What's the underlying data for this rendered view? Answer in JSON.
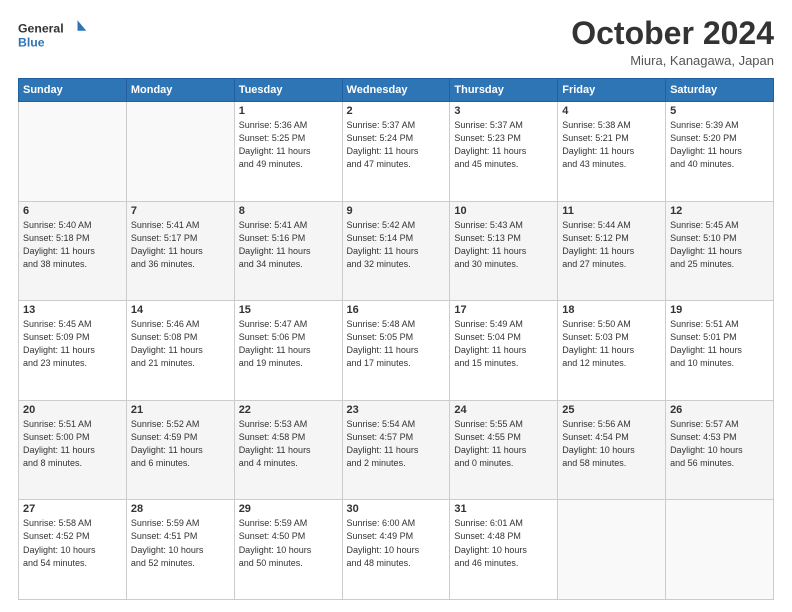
{
  "header": {
    "logo_line1": "General",
    "logo_line2": "Blue",
    "month_title": "October 2024",
    "location": "Miura, Kanagawa, Japan"
  },
  "weekdays": [
    "Sunday",
    "Monday",
    "Tuesday",
    "Wednesday",
    "Thursday",
    "Friday",
    "Saturday"
  ],
  "weeks": [
    [
      {
        "day": "",
        "info": ""
      },
      {
        "day": "",
        "info": ""
      },
      {
        "day": "1",
        "info": "Sunrise: 5:36 AM\nSunset: 5:25 PM\nDaylight: 11 hours\nand 49 minutes."
      },
      {
        "day": "2",
        "info": "Sunrise: 5:37 AM\nSunset: 5:24 PM\nDaylight: 11 hours\nand 47 minutes."
      },
      {
        "day": "3",
        "info": "Sunrise: 5:37 AM\nSunset: 5:23 PM\nDaylight: 11 hours\nand 45 minutes."
      },
      {
        "day": "4",
        "info": "Sunrise: 5:38 AM\nSunset: 5:21 PM\nDaylight: 11 hours\nand 43 minutes."
      },
      {
        "day": "5",
        "info": "Sunrise: 5:39 AM\nSunset: 5:20 PM\nDaylight: 11 hours\nand 40 minutes."
      }
    ],
    [
      {
        "day": "6",
        "info": "Sunrise: 5:40 AM\nSunset: 5:18 PM\nDaylight: 11 hours\nand 38 minutes."
      },
      {
        "day": "7",
        "info": "Sunrise: 5:41 AM\nSunset: 5:17 PM\nDaylight: 11 hours\nand 36 minutes."
      },
      {
        "day": "8",
        "info": "Sunrise: 5:41 AM\nSunset: 5:16 PM\nDaylight: 11 hours\nand 34 minutes."
      },
      {
        "day": "9",
        "info": "Sunrise: 5:42 AM\nSunset: 5:14 PM\nDaylight: 11 hours\nand 32 minutes."
      },
      {
        "day": "10",
        "info": "Sunrise: 5:43 AM\nSunset: 5:13 PM\nDaylight: 11 hours\nand 30 minutes."
      },
      {
        "day": "11",
        "info": "Sunrise: 5:44 AM\nSunset: 5:12 PM\nDaylight: 11 hours\nand 27 minutes."
      },
      {
        "day": "12",
        "info": "Sunrise: 5:45 AM\nSunset: 5:10 PM\nDaylight: 11 hours\nand 25 minutes."
      }
    ],
    [
      {
        "day": "13",
        "info": "Sunrise: 5:45 AM\nSunset: 5:09 PM\nDaylight: 11 hours\nand 23 minutes."
      },
      {
        "day": "14",
        "info": "Sunrise: 5:46 AM\nSunset: 5:08 PM\nDaylight: 11 hours\nand 21 minutes."
      },
      {
        "day": "15",
        "info": "Sunrise: 5:47 AM\nSunset: 5:06 PM\nDaylight: 11 hours\nand 19 minutes."
      },
      {
        "day": "16",
        "info": "Sunrise: 5:48 AM\nSunset: 5:05 PM\nDaylight: 11 hours\nand 17 minutes."
      },
      {
        "day": "17",
        "info": "Sunrise: 5:49 AM\nSunset: 5:04 PM\nDaylight: 11 hours\nand 15 minutes."
      },
      {
        "day": "18",
        "info": "Sunrise: 5:50 AM\nSunset: 5:03 PM\nDaylight: 11 hours\nand 12 minutes."
      },
      {
        "day": "19",
        "info": "Sunrise: 5:51 AM\nSunset: 5:01 PM\nDaylight: 11 hours\nand 10 minutes."
      }
    ],
    [
      {
        "day": "20",
        "info": "Sunrise: 5:51 AM\nSunset: 5:00 PM\nDaylight: 11 hours\nand 8 minutes."
      },
      {
        "day": "21",
        "info": "Sunrise: 5:52 AM\nSunset: 4:59 PM\nDaylight: 11 hours\nand 6 minutes."
      },
      {
        "day": "22",
        "info": "Sunrise: 5:53 AM\nSunset: 4:58 PM\nDaylight: 11 hours\nand 4 minutes."
      },
      {
        "day": "23",
        "info": "Sunrise: 5:54 AM\nSunset: 4:57 PM\nDaylight: 11 hours\nand 2 minutes."
      },
      {
        "day": "24",
        "info": "Sunrise: 5:55 AM\nSunset: 4:55 PM\nDaylight: 11 hours\nand 0 minutes."
      },
      {
        "day": "25",
        "info": "Sunrise: 5:56 AM\nSunset: 4:54 PM\nDaylight: 10 hours\nand 58 minutes."
      },
      {
        "day": "26",
        "info": "Sunrise: 5:57 AM\nSunset: 4:53 PM\nDaylight: 10 hours\nand 56 minutes."
      }
    ],
    [
      {
        "day": "27",
        "info": "Sunrise: 5:58 AM\nSunset: 4:52 PM\nDaylight: 10 hours\nand 54 minutes."
      },
      {
        "day": "28",
        "info": "Sunrise: 5:59 AM\nSunset: 4:51 PM\nDaylight: 10 hours\nand 52 minutes."
      },
      {
        "day": "29",
        "info": "Sunrise: 5:59 AM\nSunset: 4:50 PM\nDaylight: 10 hours\nand 50 minutes."
      },
      {
        "day": "30",
        "info": "Sunrise: 6:00 AM\nSunset: 4:49 PM\nDaylight: 10 hours\nand 48 minutes."
      },
      {
        "day": "31",
        "info": "Sunrise: 6:01 AM\nSunset: 4:48 PM\nDaylight: 10 hours\nand 46 minutes."
      },
      {
        "day": "",
        "info": ""
      },
      {
        "day": "",
        "info": ""
      }
    ]
  ]
}
